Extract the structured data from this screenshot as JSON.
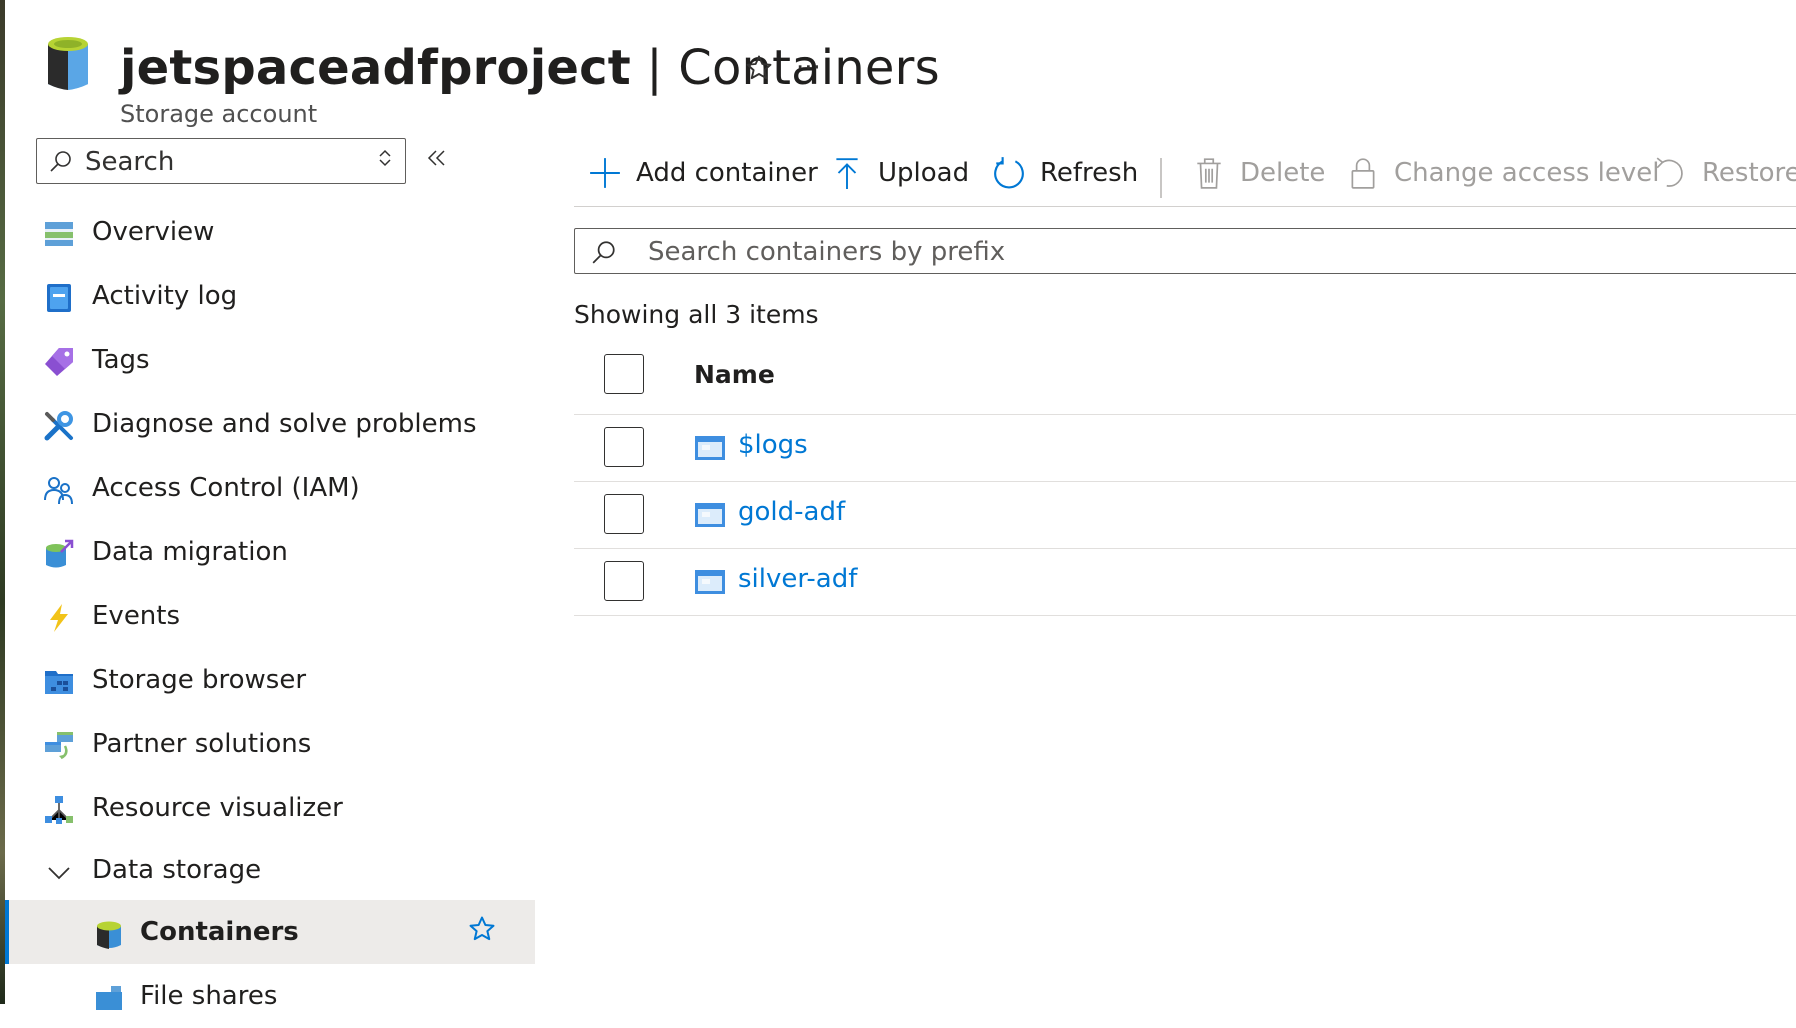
{
  "header": {
    "resource_name": "jetspaceadfproject",
    "separator": " | ",
    "page_name": "Containers",
    "subtitle": "Storage account",
    "more_label": "···"
  },
  "sidebar": {
    "search_placeholder": "Search",
    "items": [
      {
        "label": "Overview",
        "icon": "overview-icon"
      },
      {
        "label": "Activity log",
        "icon": "activity-log-icon"
      },
      {
        "label": "Tags",
        "icon": "tag-icon"
      },
      {
        "label": "Diagnose and solve problems",
        "icon": "wrench-icon"
      },
      {
        "label": "Access Control (IAM)",
        "icon": "people-icon"
      },
      {
        "label": "Data migration",
        "icon": "data-migration-icon"
      },
      {
        "label": "Events",
        "icon": "lightning-icon"
      },
      {
        "label": "Storage browser",
        "icon": "storage-browser-icon"
      },
      {
        "label": "Partner solutions",
        "icon": "partner-solutions-icon"
      },
      {
        "label": "Resource visualizer",
        "icon": "resource-visualizer-icon"
      }
    ],
    "group": {
      "label": "Data storage",
      "expanded": true
    },
    "sub_items": [
      {
        "label": "Containers",
        "icon": "container-icon",
        "active": true
      },
      {
        "label": "File shares",
        "icon": "file-share-icon",
        "active": false
      }
    ]
  },
  "toolbar": {
    "add_container": "Add container",
    "upload": "Upload",
    "refresh": "Refresh",
    "delete": "Delete",
    "change_access_level": "Change access level",
    "restore": "Restore"
  },
  "filter": {
    "placeholder": "Search containers by prefix"
  },
  "count_text": "Showing all 3 items",
  "grid": {
    "column_name": "Name",
    "rows": [
      {
        "name": "$logs"
      },
      {
        "name": "gold-adf"
      },
      {
        "name": "silver-adf"
      }
    ]
  },
  "colors": {
    "accent": "#0078d4",
    "active_bg": "#edebe9",
    "disabled_text": "#a19f9d"
  }
}
